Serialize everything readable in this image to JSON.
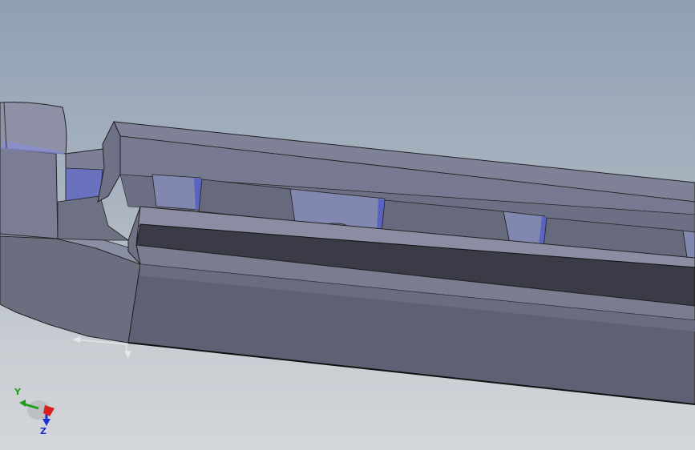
{
  "viewport": {
    "background_top": "#8fa0b4",
    "background_bottom": "#d3d6da"
  },
  "model": {
    "face_color_light": "#8a8fa6",
    "face_color_mid": "#727589",
    "face_color_dark": "#5e5f72",
    "slot_color": "#3b3b47",
    "highlight_color": "#6c74c4"
  },
  "triad": {
    "x_label": "",
    "y_label": "Y",
    "z_label": "Z",
    "x_color": "#d62020",
    "y_color": "#1ea01e",
    "z_color": "#2030d0"
  }
}
